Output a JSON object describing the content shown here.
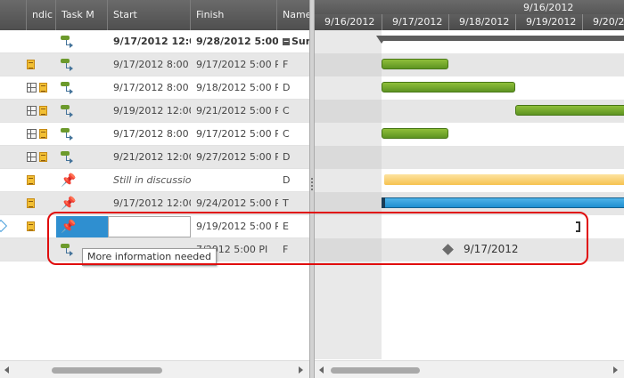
{
  "grid": {
    "columns": {
      "indicators": "ndic",
      "task_mode": "Task M",
      "start": "Start",
      "finish": "Finish",
      "name": "Name"
    },
    "rows": [
      {
        "start": "9/17/2012 12:00 ",
        "finish": "9/28/2012 5:00 I",
        "name": "Sum",
        "indicators": [],
        "mode": "auto"
      },
      {
        "start": "9/17/2012 8:00 A",
        "finish": "9/17/2012 5:00 PI",
        "name": "F",
        "indicators": [
          "note"
        ],
        "mode": "auto"
      },
      {
        "start": "9/17/2012 8:00 A",
        "finish": "9/18/2012 5:00 PI",
        "name": "D",
        "indicators": [
          "table",
          "note"
        ],
        "mode": "auto"
      },
      {
        "start": "9/19/2012 12:00 /",
        "finish": "9/21/2012 5:00 PI",
        "name": "C",
        "indicators": [
          "table",
          "note"
        ],
        "mode": "auto"
      },
      {
        "start": "9/17/2012 8:00 A",
        "finish": "9/17/2012 5:00 PI",
        "name": "C",
        "indicators": [
          "table",
          "note"
        ],
        "mode": "auto"
      },
      {
        "start": "9/21/2012 12:00 /",
        "finish": "9/27/2012 5:00 PI",
        "name": "D",
        "indicators": [
          "table",
          "note"
        ],
        "mode": "auto"
      },
      {
        "start": "Still in discussion",
        "finish": "",
        "name": "D",
        "indicators": [
          "note"
        ],
        "mode": "manual"
      },
      {
        "start": "9/17/2012 12:00 /",
        "finish": "9/24/2012 5:00 PI",
        "name": "T",
        "indicators": [
          "note"
        ],
        "mode": "manual"
      },
      {
        "start": "",
        "finish": "9/19/2012 5:00 PI",
        "name": "E",
        "indicators": [
          "note"
        ],
        "mode": "manual-question"
      },
      {
        "start": "",
        "finish": "7/2012 5:00 PI",
        "name": "F",
        "indicators": [],
        "mode": "auto"
      }
    ],
    "tooltip": "More information needed"
  },
  "gantt": {
    "week_label": "9/16/2012",
    "days": [
      "9/16/2012",
      "9/17/2012",
      "9/18/2012",
      "9/19/2012",
      "9/20/20"
    ],
    "milestone_label": "9/17/2012"
  },
  "colors": {
    "task_bar": "#6ca22c",
    "manual_bar": "#1f8fd0",
    "estimate_bar": "#f6c250",
    "highlight": "#e00d0d",
    "header": "#555555"
  }
}
